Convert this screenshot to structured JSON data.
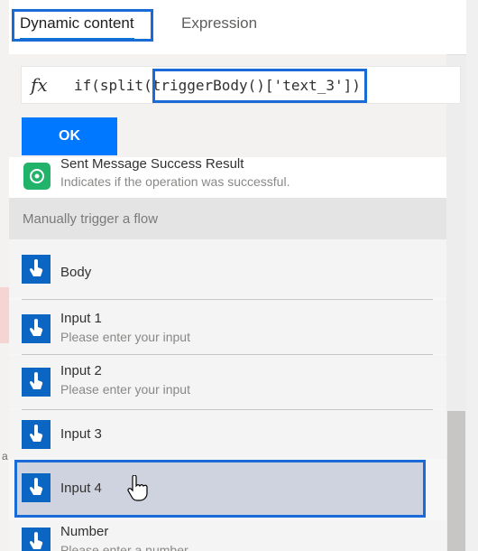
{
  "tabs": [
    {
      "label": "Dynamic content",
      "active": true
    },
    {
      "label": "Expression",
      "active": false
    }
  ],
  "expression": {
    "fx_symbol": "fx",
    "value": "if(split(triggerBody()['text_3'])"
  },
  "ok_button": {
    "label": "OK"
  },
  "sent_item": {
    "title": "Sent Message Success Result",
    "subtitle": "Indicates if the operation was successful."
  },
  "section_header": "Manually trigger a flow",
  "items": [
    {
      "title": "Body",
      "subtitle": ""
    },
    {
      "title": "Input 1",
      "subtitle": "Please enter your input"
    },
    {
      "title": "Input 2",
      "subtitle": "Please enter your input"
    },
    {
      "title": "Input 3",
      "subtitle": ""
    },
    {
      "title": "Input 4",
      "subtitle": ""
    },
    {
      "title": "Number",
      "subtitle": "Please enter a number"
    }
  ],
  "backdrop_letter": "a",
  "colors": {
    "accent": "#0078d4",
    "ok": "#0078ff",
    "icon": "#0a66c2",
    "highlight": "#1a6bd6"
  }
}
